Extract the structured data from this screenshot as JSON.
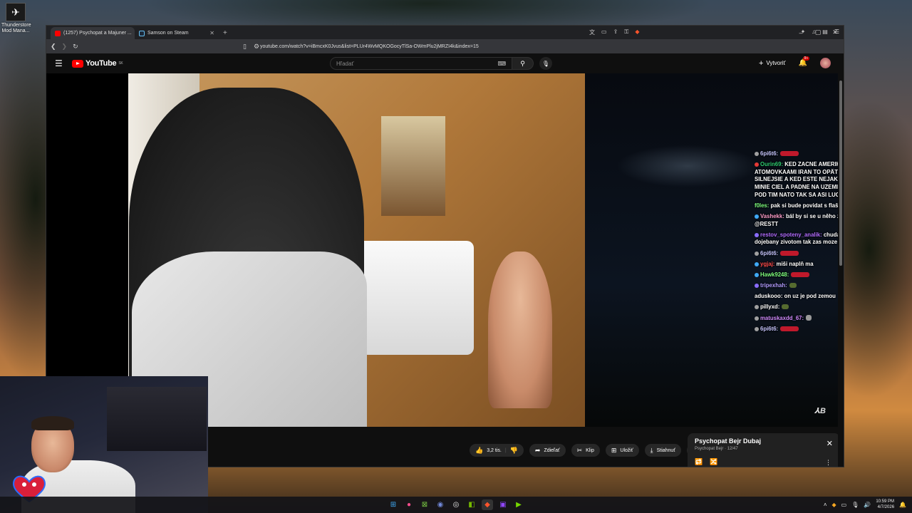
{
  "desktop": {
    "icon_label": "Thunderstore Mod Mana..."
  },
  "browser": {
    "tabs": [
      {
        "title": "(1257) Psychopat a Majuner ...",
        "favicon_color": "#ff0000",
        "active": true
      },
      {
        "title": "Samson on Steam",
        "favicon_color": "#1b2838",
        "active": false
      }
    ],
    "new_tab": "+",
    "url": "youtube.com/watch?v=iBmcxK0Jvus&list=PLUr4WvMQKOGocyTlSa-OWmPlu2jMRZI4k&index=15",
    "window_controls": [
      "–",
      "▢",
      "✕"
    ]
  },
  "youtube": {
    "logo_text": "YouTube",
    "country": "SK",
    "search_placeholder": "Hľadať",
    "create_label": "Vytvoriť",
    "notification_count": "9+"
  },
  "chat": [
    {
      "user": "6pi6t6:",
      "user_color": "#c6c6ff",
      "badge_color": "#a0a0a0",
      "text": "",
      "emote": "red"
    },
    {
      "user": "Ourin69:",
      "user_color": "#2ecc71",
      "badge_color": "#e53935",
      "text": "KED ZACNE AMERIKA S ATOMOVKAAMI IRAN TO OPÄTUJE A ESTE SILNEJSIE A KED ESTE NEJAKA RAKETA MINIE CIEL A PADNE NA UZEMIE KDE JE POD TIM NATO TAK SA ASI LUCIME NO"
    },
    {
      "user": "f0les:",
      "user_color": "#7fff7f",
      "badge_color": "",
      "text": "pak si bude povidat s flaškou",
      "emote": "small"
    },
    {
      "user": "Vashekk:",
      "user_color": "#ff9ecb",
      "badge_color": "#3fa9f5",
      "text": "bál by si se u něho zaspat? @RESTT"
    },
    {
      "user": "restov_spoteny_analik:",
      "user_color": "#b16cff",
      "badge_color": "#8a6cff",
      "text": "chudak aky je dojebany zivotom tak zas moze si za to sam"
    },
    {
      "user": "6pi6t6:",
      "user_color": "#c6c6ff",
      "badge_color": "#a0a0a0",
      "text": "",
      "emote": "red"
    },
    {
      "user": "ygjaj:",
      "user_color": "#ff4d4d",
      "badge_color": "#3fa9f5",
      "text": "miši naplň ma"
    },
    {
      "user": "Hawk9248:",
      "user_color": "#7fff7f",
      "badge_color": "#3fa9f5",
      "text": "",
      "emote": "red"
    },
    {
      "user": "tripexhah:",
      "user_color": "#b19cff",
      "badge_color": "#8a6cff",
      "text": "",
      "emote": "small"
    },
    {
      "user": "aduskooo:",
      "user_color": "#ffffff",
      "badge_color": "",
      "text": "on uz je pod zemou"
    },
    {
      "user": "pillyxd:",
      "user_color": "#ffffff",
      "badge_color": "#a0a0a0",
      "text": "",
      "emote": "small"
    },
    {
      "user": "matuskaxdd_67:",
      "user_color": "#d18cff",
      "badge_color": "#a0a0a0",
      "text": "",
      "emote": "hat"
    },
    {
      "user": "6pi6t6:",
      "user_color": "#c6c6ff",
      "badge_color": "#a0a0a0",
      "text": "",
      "emote": "red"
    }
  ],
  "actions": {
    "like_count": "3,2 tis.",
    "share": "Zdieľať",
    "clip": "Klip",
    "save": "Uložiť",
    "download": "Stiahnuť",
    "more": "⋯"
  },
  "miniplayer": {
    "title": "Psychopat Bejr  Dubaj",
    "subtitle": "Psychopat Bejr · 12/47"
  },
  "tray": {
    "time": "10:59 PM",
    "date": "4/7/2026"
  }
}
